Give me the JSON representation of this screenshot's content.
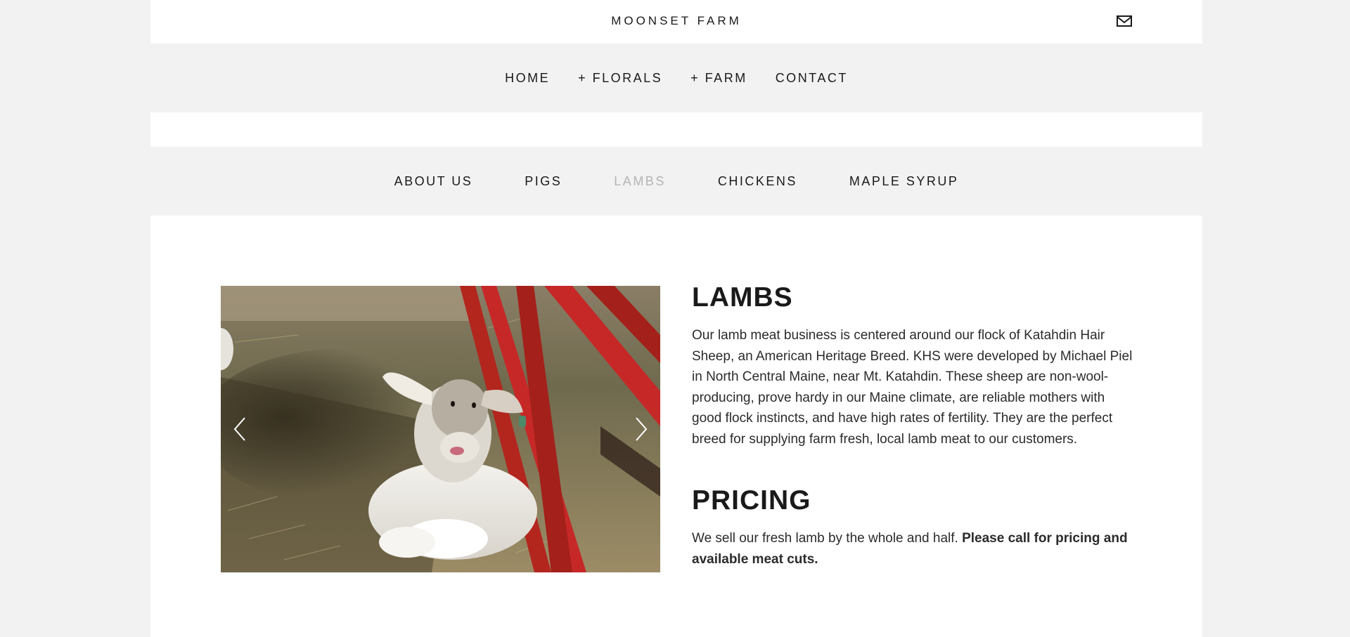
{
  "header": {
    "site_title": "MOONSET FARM",
    "mail_icon": "envelope-icon"
  },
  "main_nav": [
    {
      "label": "HOME"
    },
    {
      "label": "+ FLORALS"
    },
    {
      "label": "+ FARM"
    },
    {
      "label": "CONTACT"
    }
  ],
  "sub_nav": [
    {
      "label": "ABOUT US",
      "active": false
    },
    {
      "label": "PIGS",
      "active": false
    },
    {
      "label": "LAMBS",
      "active": true
    },
    {
      "label": "CHICKENS",
      "active": false
    },
    {
      "label": "MAPLE SYRUP",
      "active": false
    }
  ],
  "slideshow": {
    "image_alt": "Lamb lying in hay next to red metal gate",
    "prev_icon": "chevron-left-icon",
    "next_icon": "chevron-right-icon"
  },
  "lambs": {
    "heading": "LAMBS",
    "body": "Our lamb meat business is centered around our flock of Katahdin Hair Sheep, an American Heritage Breed. KHS were developed by Michael Piel in North Central Maine, near Mt. Katahdin. These sheep are non-wool-producing, prove hardy in our Maine climate, are reliable mothers with good flock instincts, and have high rates of fertility. They are the perfect breed for supplying farm fresh, local lamb meat to our customers."
  },
  "pricing": {
    "heading": "PRICING",
    "body_plain": "We sell our fresh lamb by the whole and half. ",
    "body_bold": "Please call for pricing and available meat cuts."
  },
  "colors": {
    "page_bg": "#f2f2f2",
    "panel_bg": "#ffffff",
    "text": "#1a1a1a",
    "active_nav": "#b4b4b4",
    "gate_red": "#c62828"
  }
}
